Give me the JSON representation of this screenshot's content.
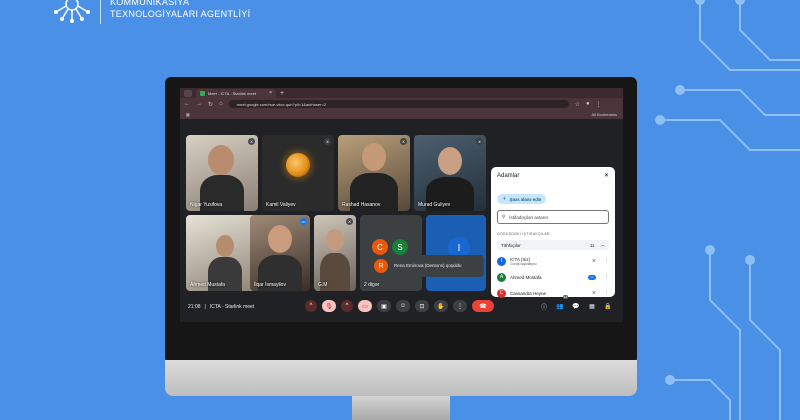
{
  "org": {
    "line1": "KOMMUNİKASİYA",
    "line2": "TEXNOLOGİYALARI AGENTLİYİ"
  },
  "browser": {
    "tab_title": "Meet - ICTA - Starlink meet",
    "tab_close": "×",
    "new_tab": "+",
    "url": "meet.google.com/nue-vkcc-quh?pli=1&authuser=2",
    "bookmarks_label": "All Bookmarks"
  },
  "tiles": [
    {
      "name": "Nigar Yusifova"
    },
    {
      "name": "Kamil Valiyev"
    },
    {
      "name": "Rashad Hasanov"
    },
    {
      "name": "Murad Guliyev"
    },
    {
      "name": "Ahmed Mustafa"
    },
    {
      "name": "İlqar İsmayilov"
    },
    {
      "name": "G.M"
    },
    {
      "name": "2 digər",
      "avatars": [
        "C",
        "S"
      ]
    },
    {
      "name": "",
      "avatar": "I"
    }
  ],
  "toast": {
    "avatar": "R",
    "message": "Rena Eminova (Dentons) qoşuldu"
  },
  "bottombar": {
    "time": "21:08",
    "separator": "|",
    "meeting": "ICTA - Starlink meet",
    "participant_count": "11"
  },
  "people_panel": {
    "title": "Adamlar",
    "add_label": "Şəxs əlavə edin",
    "search_placeholder": "İstifadəçiləri axtarın",
    "section_label": "GÖRÜŞDƏKİ İŞTİRAKÇILAR",
    "group_label": "Töhfəçilər",
    "group_count": "11",
    "people": [
      {
        "initial": "I",
        "name": "ICTA (Siz)",
        "sub": "Görüş təşkilatçısı",
        "color": "#1967d2"
      },
      {
        "initial": "A",
        "name": "Ahmed Mostafa",
        "sub": "",
        "color": "#188038"
      },
      {
        "initial": "C",
        "name": "Cassandra Heyne",
        "sub": "",
        "color": "#d93025"
      }
    ]
  },
  "colors": {
    "background": "#4a90e6",
    "end_call": "#ea4335",
    "muted": "#f6c3bf"
  }
}
